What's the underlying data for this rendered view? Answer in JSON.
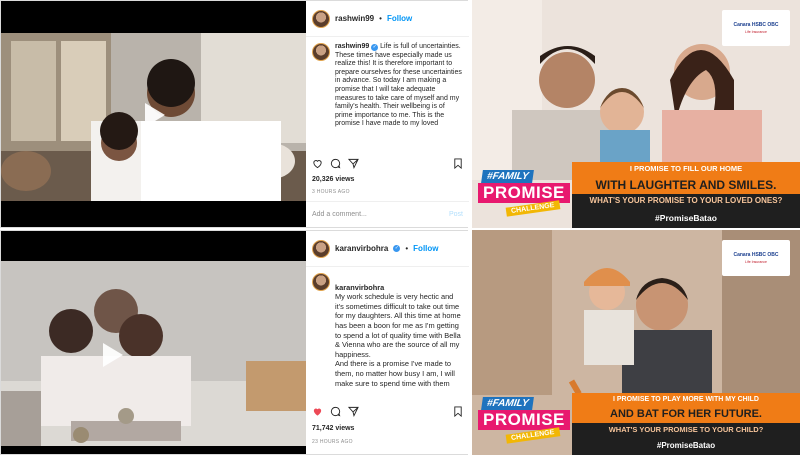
{
  "posts": [
    {
      "username": "rashwin99",
      "follow_label": "Follow",
      "caption_user": "rashwin99",
      "caption": "Life is full of uncertainties. These times have especially made us realize this! It is therefore important to prepare ourselves for these uncertainties in advance. So today I am making a promise that I will take adequate measures to take care of myself and my family's health. Their wellbeing is of prime importance to me. This is the promise I have made to my loved",
      "views": "20,326 views",
      "time_ago": "3 HOURS AGO",
      "comment_placeholder": "Add a comment...",
      "post_label": "Post",
      "liked": false
    },
    {
      "username": "karanvirbohra",
      "follow_label": "Follow",
      "caption_user": "karanvirbohra",
      "caption": "My work schedule is very hectic and it's sometimes difficult to take out time for my daughters. All this time at home has been a boon for me as I'm getting to spend a lot of quality time with Bella & Vienna who are the source of all my happiness.\nAnd there is a promise I've made to them, no matter how busy I am, I will make sure to spend time with them",
      "views": "71,742 views",
      "time_ago": "23 HOURS AGO",
      "liked": true
    }
  ],
  "ads": [
    {
      "bank": "Canara HSBC OBC",
      "bank_sub": "Life Insurance",
      "badge_family": "#FAMILY",
      "badge_promise": "PROMISE",
      "badge_challenge": "CHALLENGE",
      "line1": "I PROMISE TO FILL OUR HOME",
      "line2": "WITH LAUGHTER AND SMILES.",
      "line3": "WHAT'S YOUR PROMISE TO YOUR LOVED ONES?",
      "hashtag": "#PromiseBatao"
    },
    {
      "bank": "Canara HSBC OBC",
      "bank_sub": "Life Insurance",
      "badge_family": "#FAMILY",
      "badge_promise": "PROMISE",
      "badge_challenge": "CHALLENGE",
      "line1": "I PROMISE TO PLAY MORE WITH MY CHILD",
      "line2": "AND BAT FOR HER FUTURE.",
      "line3": "WHAT'S YOUR PROMISE TO YOUR CHILD?",
      "hashtag": "#PromiseBatao"
    }
  ],
  "colors": {
    "follow": "#0095f6",
    "like_active": "#ed4956",
    "banner_orange": "#f07c16",
    "badge_blue": "#1e73be",
    "badge_pink": "#e8196f",
    "badge_yellow": "#f2b705"
  }
}
